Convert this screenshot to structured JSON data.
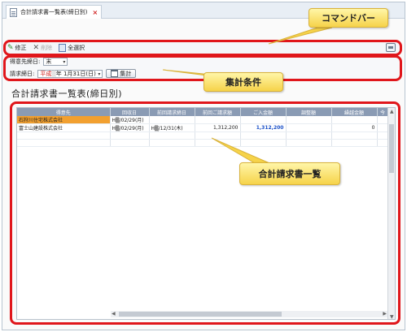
{
  "tab": {
    "title": "合計請求書一覧表(締日別)",
    "close": "×"
  },
  "toolbar": {
    "edit": "修正",
    "delete": "削除",
    "select_all": "全選択"
  },
  "conditions": {
    "closing_day_label": "得意先締日:",
    "closing_day_value": "末",
    "billing_date_label": "請求締日:",
    "billing_date_era": "平成",
    "billing_date_value": "年 1月31日(日)",
    "sum_button": "集計"
  },
  "page_title": "合計請求書一覧表(締日別)",
  "table": {
    "columns": [
      "得意先",
      "回収日",
      "前回請求締日",
      "前回ご請求額",
      "ご入金額",
      "調整額",
      "繰越金額",
      "今"
    ],
    "rows": [
      [
        "石狩川住宅株式会社",
        "H▒/02/29(月)",
        "",
        "",
        "",
        "",
        "",
        ""
      ],
      [
        "富士山建設株式会社",
        "H▒/02/29(月)",
        "H▒/12/31(木)",
        "1,312,200",
        "1,312,200",
        "",
        "0",
        ""
      ]
    ]
  },
  "callouts": {
    "command_bar": "コマンドバー",
    "conditions": "集計条件",
    "list": "合計請求書一覧"
  },
  "colors": {
    "highlight": "#e0161b",
    "header": "#8a9bb4",
    "selected": "#f2a030",
    "callout": "#f6d34a"
  }
}
